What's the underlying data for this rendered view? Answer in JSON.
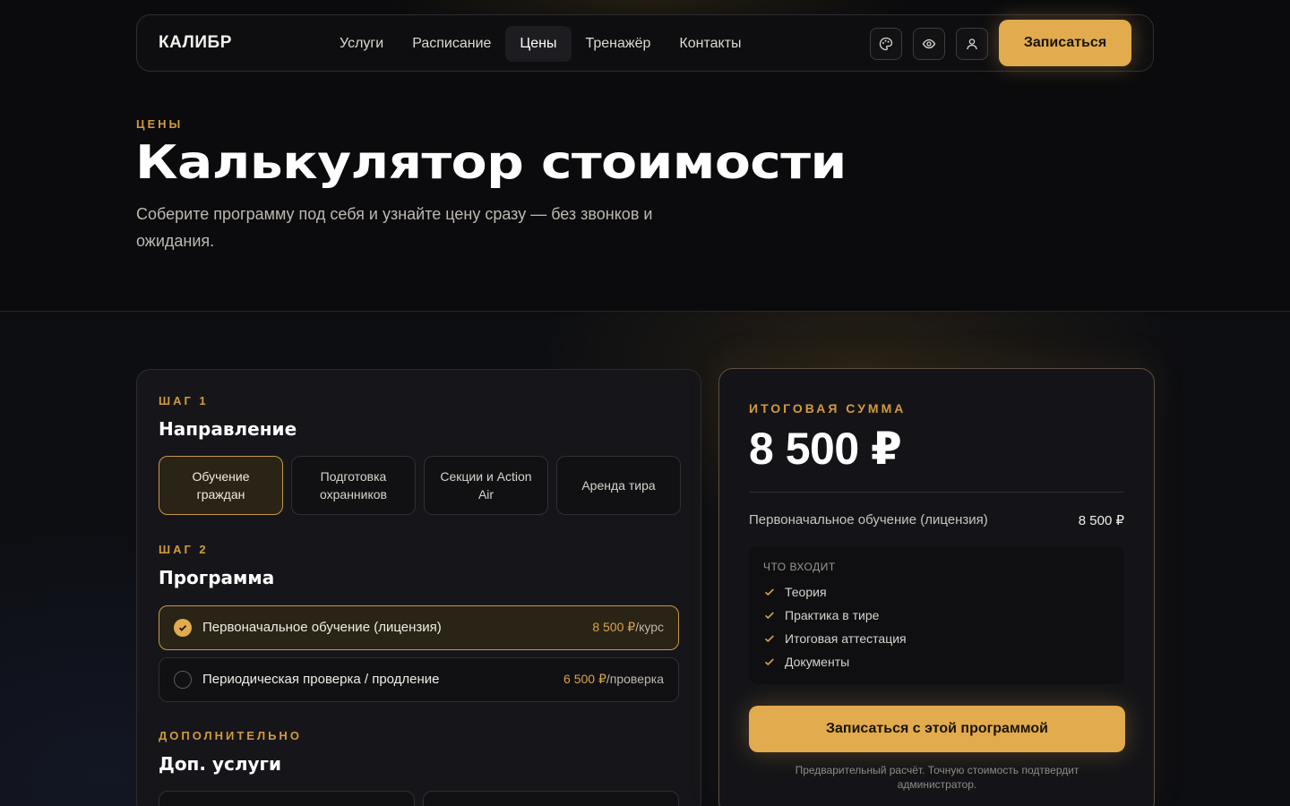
{
  "nav": {
    "logo": "КАЛИБР",
    "links": [
      {
        "label": "Услуги"
      },
      {
        "label": "Расписание"
      },
      {
        "label": "Цены"
      },
      {
        "label": "Тренажёр"
      },
      {
        "label": "Контакты"
      }
    ],
    "active_link": "Цены",
    "icons": [
      "palette-icon",
      "eye-icon",
      "user-icon"
    ],
    "cta_label": "Записаться"
  },
  "hero": {
    "eyebrow": "ЦЕНЫ",
    "title": "Калькулятор стоимости",
    "subtitle": "Соберите программу под себя и узнайте цену сразу — без звонков и ожидания."
  },
  "calculator": {
    "step1": {
      "label": "ШАГ 1",
      "title": "Направление",
      "options": [
        "Обучение граждан",
        "Подготовка охранников",
        "Секции и Action Air",
        "Аренда тира"
      ],
      "selected": "Обучение граждан"
    },
    "step2": {
      "label": "ШАГ 2",
      "title": "Программа",
      "programs": [
        {
          "name": "Первоначальное обучение (лицензия)",
          "price": "8 500 ₽",
          "unit": "/курс",
          "selected": true
        },
        {
          "name": "Периодическая проверка / продление",
          "price": "6 500 ₽",
          "unit": "/проверка",
          "selected": false
        }
      ]
    },
    "extras": {
      "label": "ДОПОЛНИТЕЛЬНО",
      "title": "Доп. услуги"
    }
  },
  "summary": {
    "label": "ИТОГОВАЯ СУММА",
    "total": "8 500 ₽",
    "line_name": "Первоначальное обучение (лицензия)",
    "line_price": "8 500 ₽",
    "includes_title": "ЧТО ВХОДИТ",
    "includes": [
      "Теория",
      "Практика в тире",
      "Итоговая аттестация",
      "Документы"
    ],
    "button_label": "Записаться с этой программой",
    "note": "Предварительный расчёт. Точную стоимость подтвердит администратор."
  },
  "colors": {
    "accent": "#e2ab4d",
    "eyebrow": "#d39a3e",
    "background": "#0b0b0d",
    "card": "#16161a"
  }
}
